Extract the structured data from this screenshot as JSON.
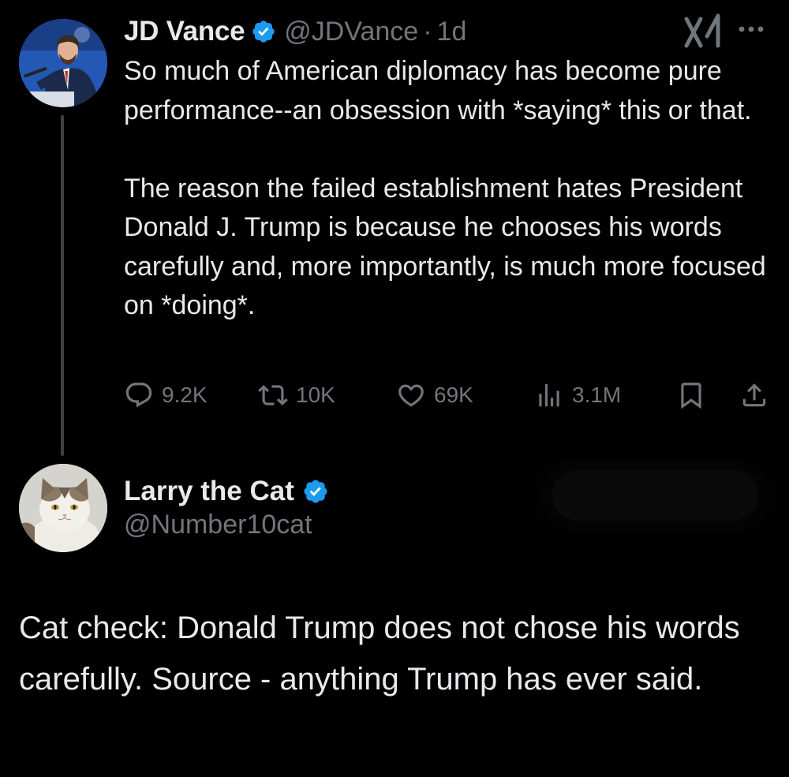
{
  "original_tweet": {
    "author": {
      "display_name": "JD Vance",
      "handle": "@JDVance",
      "verified": true,
      "avatar_icon": "profile-photo"
    },
    "separator": "·",
    "time": "1d",
    "text_paragraphs": [
      "So much of American diplomacy has become pure performance--an obsession with *saying* this or that.",
      "The reason the failed establishment hates President Donald J. Trump is because he chooses his words carefully and, more importantly, is much more focused on *doing*."
    ],
    "stats": {
      "replies": "9.2K",
      "reposts": "10K",
      "likes": "69K",
      "views": "3.1M"
    },
    "icons": {
      "reply": "reply-icon",
      "repost": "repost-icon",
      "like": "heart-icon",
      "views": "views-icon",
      "bookmark": "bookmark-icon",
      "share": "share-icon",
      "grok": "grok-icon",
      "more": "more-icon"
    }
  },
  "reply": {
    "author": {
      "display_name": "Larry the Cat",
      "handle": "@Number10cat",
      "verified": true,
      "avatar_icon": "cat-photo"
    },
    "text": "Cat check: Donald Trump does not chose his words carefully. Source - anything Trump has ever said."
  },
  "colors": {
    "background": "#000000",
    "text_primary": "#e7e9ea",
    "text_secondary": "#71767b",
    "verified_blue": "#1d9bf0",
    "thread_line": "#3e4144"
  }
}
